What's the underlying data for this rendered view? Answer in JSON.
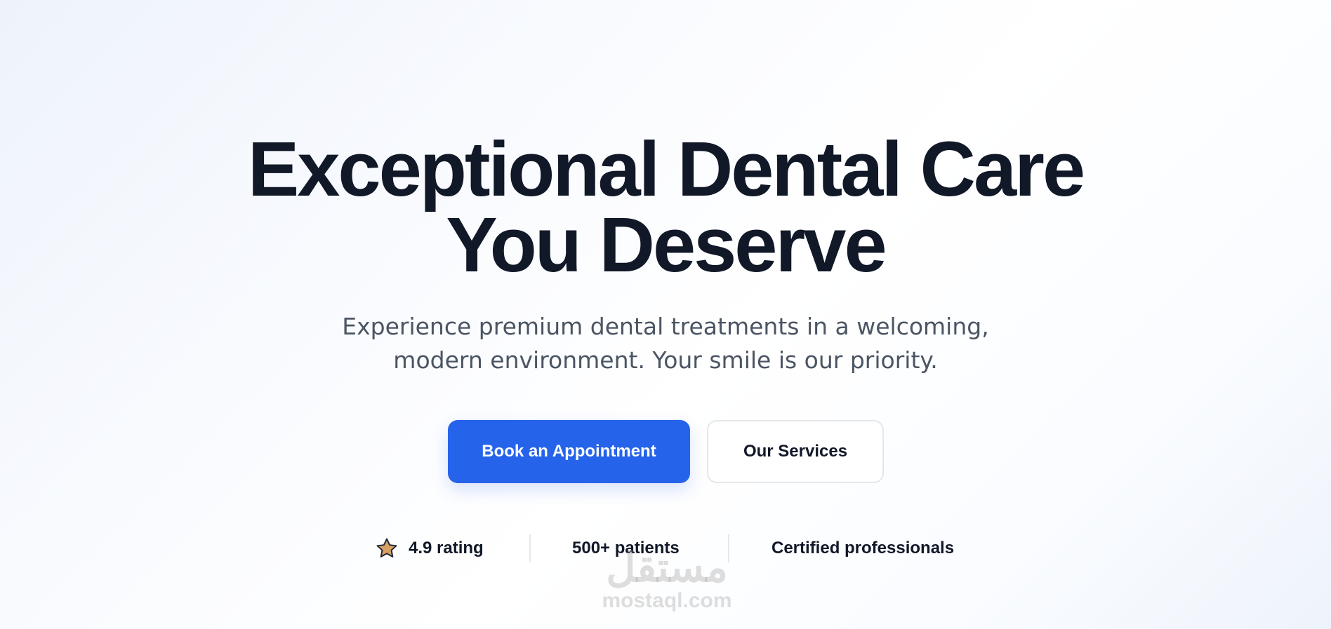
{
  "hero": {
    "headline_line1": "Exceptional Dental Care",
    "headline_line2": "You Deserve",
    "subtitle_line1": "Experience premium dental treatments in a welcoming,",
    "subtitle_line2": "modern environment. Your smile is our priority."
  },
  "buttons": {
    "primary_label": "Book an Appointment",
    "secondary_label": "Our Services"
  },
  "stats": {
    "rating_label": "4.9 rating",
    "patients_label": "500+ patients",
    "certified_label": "Certified professionals",
    "rating_icon": "star-icon"
  },
  "watermark": {
    "arabic_text": "مستقل",
    "site_text": "mostaql.com"
  },
  "colors": {
    "primary": "#2563eb",
    "headline": "#111827",
    "subtitle": "#4b5563",
    "star_fill": "#d9a064",
    "border": "#e5e7eb"
  }
}
